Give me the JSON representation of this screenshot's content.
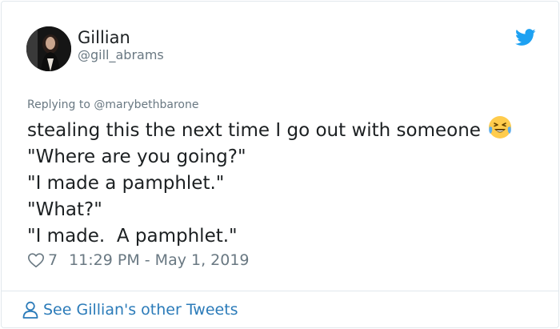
{
  "author": {
    "name": "Gillian",
    "handle": "@gill_abrams"
  },
  "reply": {
    "prefix": "Replying to",
    "mention": "@marybethbarone"
  },
  "tweet": {
    "lines": [
      "stealing this the next time I go out with someone",
      "\"Where are you going?\"",
      "\"I made a pamphlet.\"",
      "\"What?\"",
      "\"I made.  A pamphlet.\""
    ],
    "emoji": "face-with-tears-of-joy"
  },
  "meta": {
    "likes": "7",
    "timestamp": "11:29 PM - May 1, 2019"
  },
  "footer": {
    "link_label": "See Gillian's other Tweets"
  },
  "colors": {
    "twitter_blue": "#1da1f2",
    "link_blue": "#2b7bb9",
    "muted_gray": "#697882",
    "text": "#1c2022"
  },
  "icons": [
    "twitter-bird-icon",
    "heart-icon",
    "person-icon",
    "laughing-emoji-icon"
  ]
}
